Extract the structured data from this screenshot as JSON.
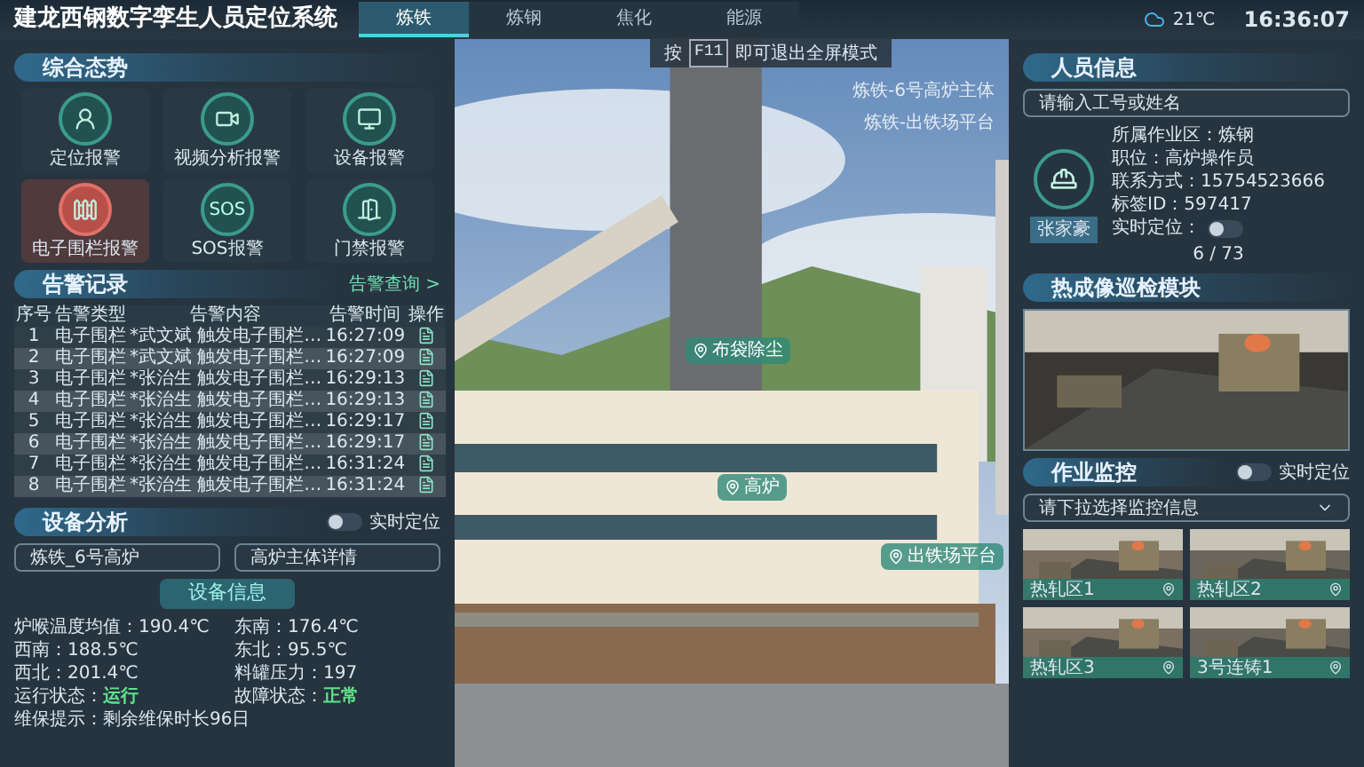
{
  "header": {
    "title": "建龙西钢数字孪生人员定位系统",
    "tabs": [
      {
        "label": "炼铁",
        "selected": true
      },
      {
        "label": "炼钢",
        "selected": false
      },
      {
        "label": "焦化",
        "selected": false
      },
      {
        "label": "能源",
        "selected": false
      }
    ],
    "weather": "21℃",
    "time": "16:36:07"
  },
  "hint": {
    "prefix": "按",
    "key": "F11",
    "suffix": "即可退出全屏模式"
  },
  "scene": {
    "captions": [
      "炼铁-6号高炉主体",
      "炼铁-出铁场平台"
    ],
    "markers": [
      "布袋除尘",
      "高炉",
      "出铁场平台"
    ]
  },
  "overview": {
    "title": "综合态势",
    "tiles": [
      {
        "label": "定位报警",
        "alert": false
      },
      {
        "label": "视频分析报警",
        "alert": false
      },
      {
        "label": "设备报警",
        "alert": false
      },
      {
        "label": "电子围栏报警",
        "alert": true
      },
      {
        "label": "SOS报警",
        "alert": false,
        "glyph": "SOS"
      },
      {
        "label": "门禁报警",
        "alert": false
      }
    ]
  },
  "alarms": {
    "title": "告警记录",
    "link": "告警查询 >",
    "columns": [
      "序号",
      "告警类型",
      "告警内容",
      "告警时间",
      "操作"
    ],
    "rows": [
      [
        "1",
        "电子围栏",
        "*武文斌 触发电子围栏…",
        "16:27:09"
      ],
      [
        "2",
        "电子围栏",
        "*武文斌 触发电子围栏…",
        "16:27:09"
      ],
      [
        "3",
        "电子围栏",
        "*张治生 触发电子围栏…",
        "16:29:13"
      ],
      [
        "4",
        "电子围栏",
        "*张治生 触发电子围栏…",
        "16:29:13"
      ],
      [
        "5",
        "电子围栏",
        "*张治生 触发电子围栏…",
        "16:29:17"
      ],
      [
        "6",
        "电子围栏",
        "*张治生 触发电子围栏…",
        "16:29:17"
      ],
      [
        "7",
        "电子围栏",
        "*张治生 触发电子围栏…",
        "16:31:24"
      ],
      [
        "8",
        "电子围栏",
        "*张治生 触发电子围栏…",
        "16:31:24"
      ]
    ]
  },
  "equipment": {
    "title": "设备分析",
    "toggle": {
      "label": "实时定位",
      "on": false
    },
    "selects": [
      "炼铁_6号高炉",
      "高炉主体详情"
    ],
    "info_title": "设备信息",
    "fields": [
      {
        "label": "炉喉温度均值：",
        "value": "190.4℃",
        "highlight": false
      },
      {
        "label": "东南：",
        "value": "176.4℃",
        "highlight": false
      },
      {
        "label": "西南：",
        "value": "188.5℃",
        "highlight": false
      },
      {
        "label": "东北：",
        "value": "95.5℃",
        "highlight": false
      },
      {
        "label": "西北：",
        "value": "201.4℃",
        "highlight": false
      },
      {
        "label": "料罐压力：",
        "value": "197",
        "highlight": false
      },
      {
        "label": "运行状态：",
        "value": "运行",
        "highlight": true
      },
      {
        "label": "故障状态：",
        "value": "正常",
        "highlight": true
      },
      {
        "label": "维保提示：",
        "value": "剩余维保时长96日",
        "highlight": false
      }
    ]
  },
  "personnel": {
    "title": "人员信息",
    "search": {
      "placeholder": "请输入工号或姓名"
    },
    "fields": [
      {
        "label": "所属作业区：",
        "value": "炼钢"
      },
      {
        "label": "职位：",
        "value": "高炉操作员"
      },
      {
        "label": "联系方式：",
        "value": "15754523666"
      },
      {
        "label": "标签ID：",
        "value": "597417"
      }
    ],
    "locate": {
      "label": "实时定位：",
      "on": false
    },
    "name": "张家豪",
    "page": "6 / 73"
  },
  "thermal": {
    "title": "热成像巡检模块"
  },
  "monitoring": {
    "title": "作业监控",
    "toggle": {
      "label": "实时定位",
      "on": false
    },
    "select": {
      "placeholder": "请下拉选择监控信息"
    },
    "cameras": [
      "热轧区1",
      "热轧区2",
      "热轧区3",
      "3号连铸1"
    ]
  }
}
